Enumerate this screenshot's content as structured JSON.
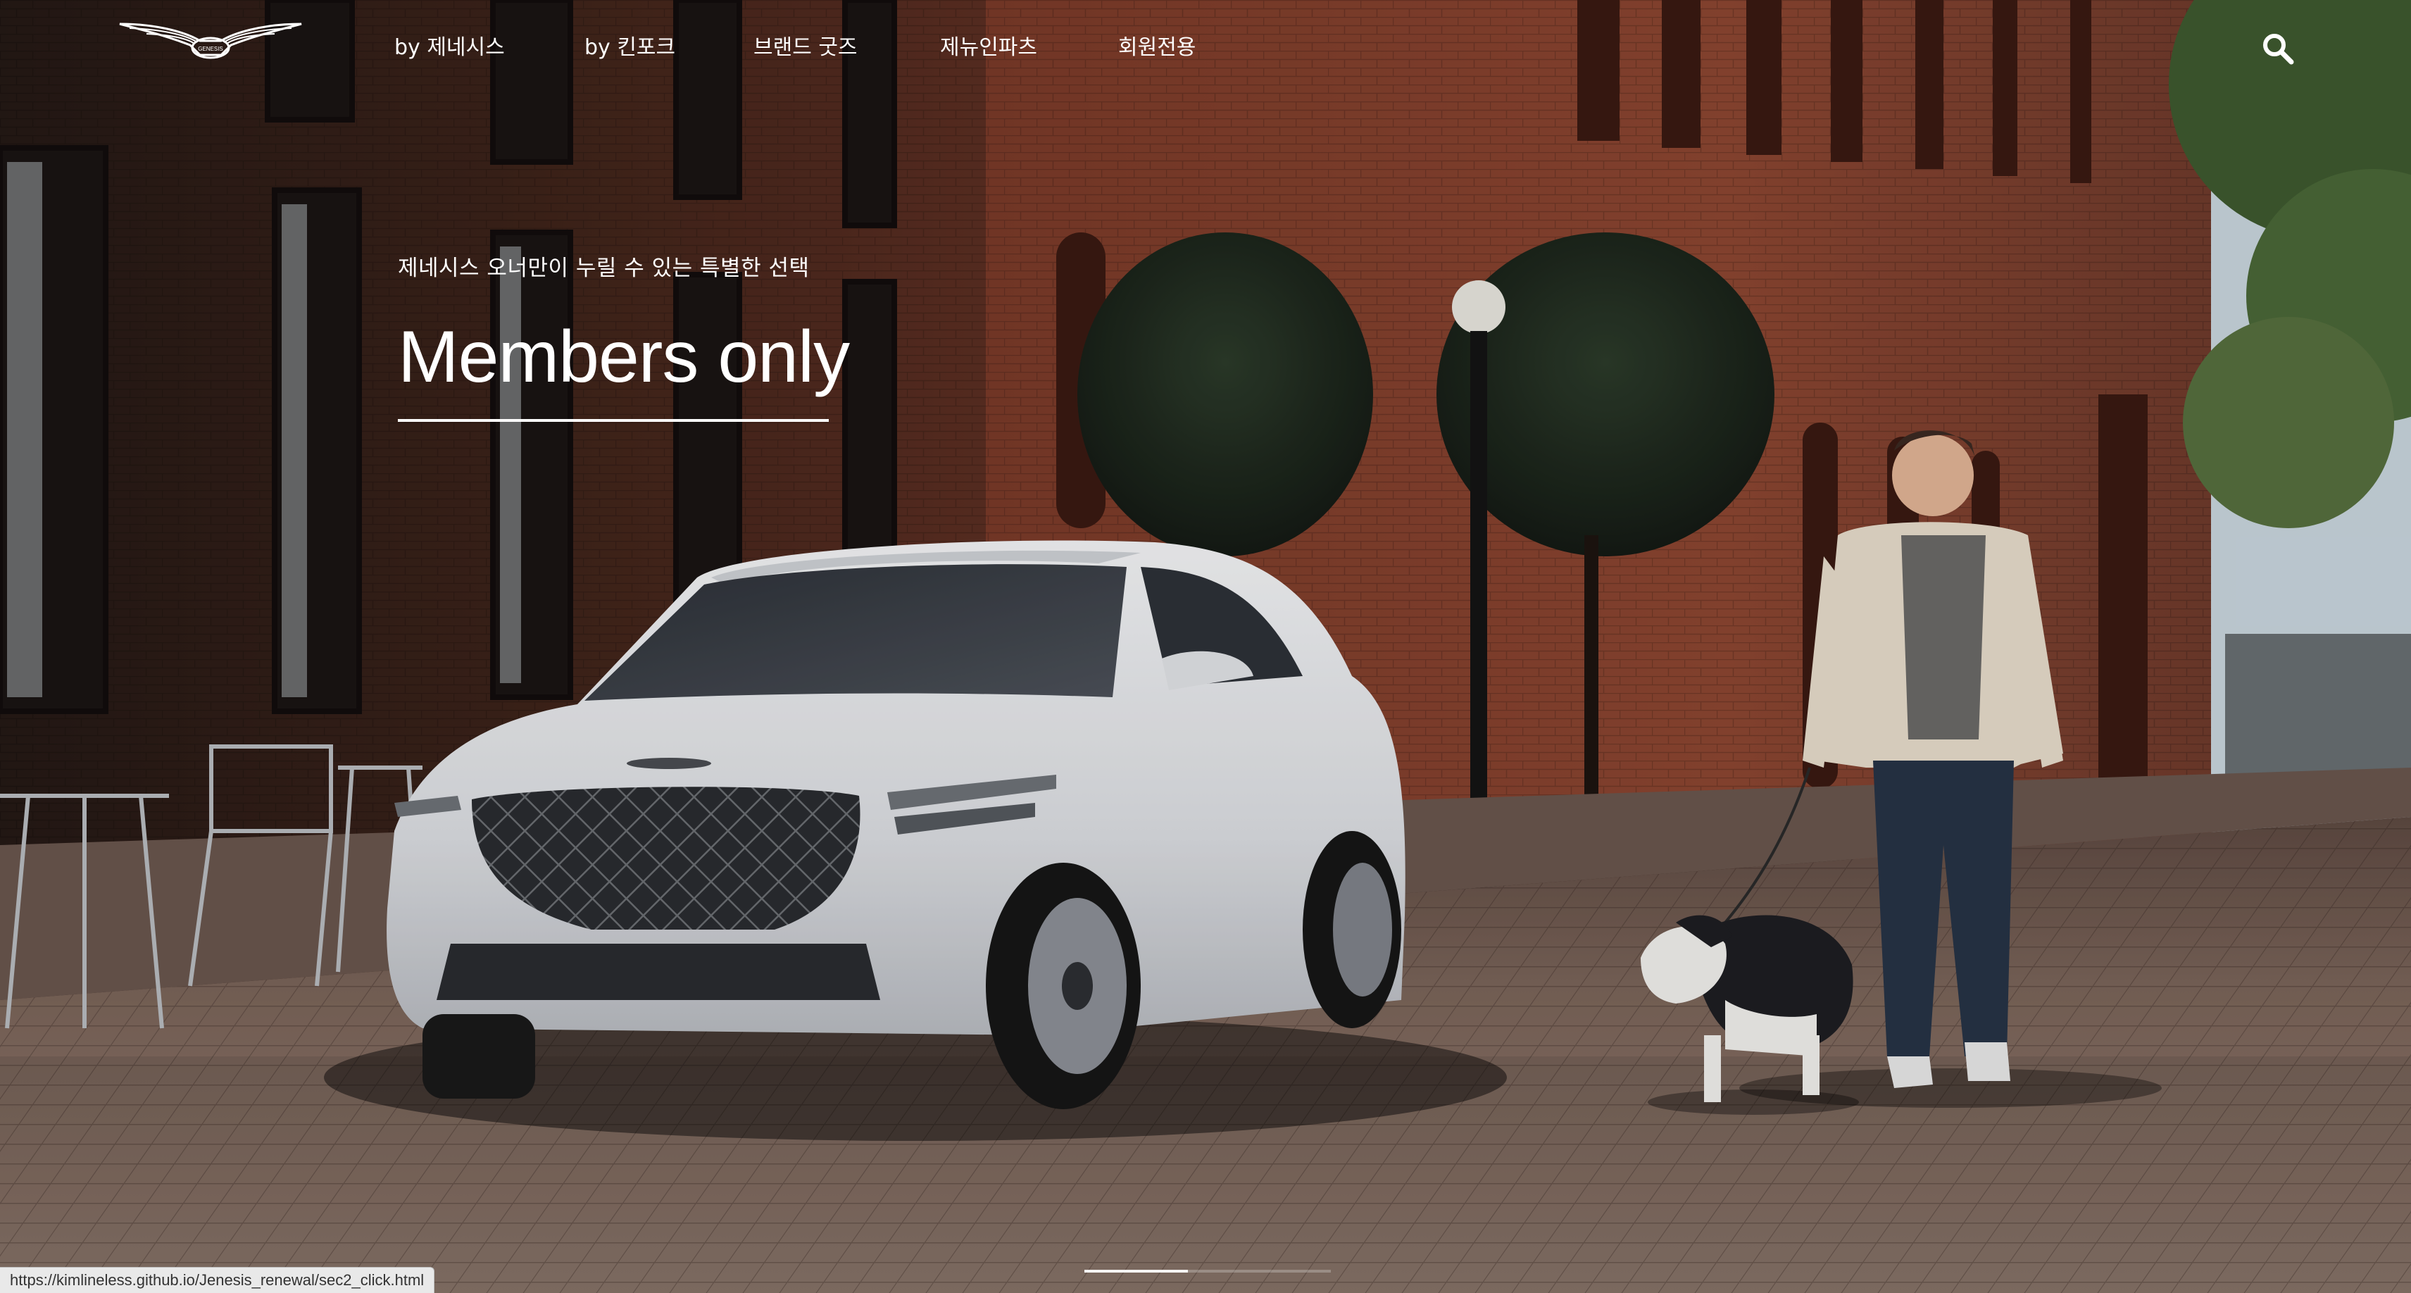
{
  "header": {
    "logo_text": "GENESIS",
    "logo_icon": "genesis-wings-logo",
    "nav": [
      {
        "label": "by 제네시스"
      },
      {
        "label": "by 킨포크"
      },
      {
        "label": "브랜드 굿즈"
      },
      {
        "label": "제뉴인파츠"
      },
      {
        "label": "회원전용"
      }
    ],
    "search_icon": "search-icon"
  },
  "hero": {
    "subtitle": "제네시스 오너만이 누릴 수 있는 특별한 선택",
    "title": "Members only",
    "image": "white-genesis-suv-man-walking-dog-brick-street",
    "slide_progress": 0.42
  },
  "status_bar": {
    "url": "https://kimlineless.github.io/Jenesis_renewal/sec2_click.html"
  },
  "colors": {
    "text": "#ffffff",
    "brick": "#6b3426",
    "pavement": "#8a7468",
    "car": "#e8e9ec"
  }
}
